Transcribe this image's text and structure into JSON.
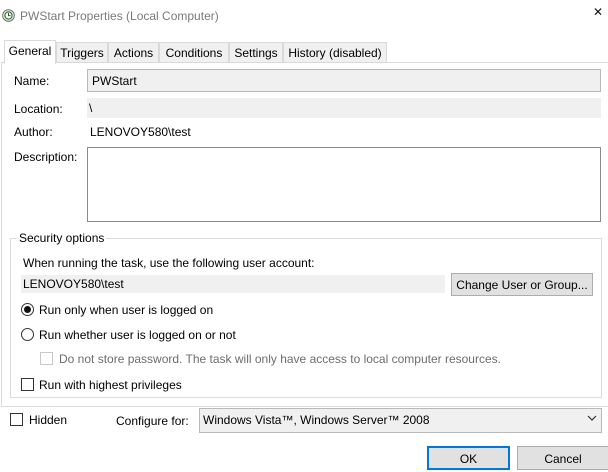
{
  "window": {
    "title": "PWStart Properties (Local Computer)",
    "close_glyph": "✕"
  },
  "tabs": [
    {
      "label": "General",
      "active": true
    },
    {
      "label": "Triggers"
    },
    {
      "label": "Actions"
    },
    {
      "label": "Conditions"
    },
    {
      "label": "Settings"
    },
    {
      "label": "History (disabled)"
    }
  ],
  "general": {
    "name_label": "Name:",
    "name_value": "PWStart",
    "location_label": "Location:",
    "location_value": "\\",
    "author_label": "Author:",
    "author_value": "LENOVOY580\\test",
    "description_label": "Description:",
    "description_value": ""
  },
  "security": {
    "legend": "Security options",
    "account_prompt": "When running the task, use the following user account:",
    "account_value": "LENOVOY580\\test",
    "change_button": "Change User or Group...",
    "radio_logged_on": "Run only when user is logged on",
    "radio_logged_on_checked": true,
    "radio_whether": "Run whether user is logged on or not",
    "no_store_password": "Do not store password.  The task will only have access to local computer resources.",
    "highest_privileges": "Run with highest privileges"
  },
  "footer": {
    "hidden_label": "Hidden",
    "configure_label": "Configure for:",
    "configure_value": "Windows Vista™, Windows Server™ 2008",
    "ok_button": "OK",
    "cancel_button": "Cancel"
  },
  "colors": {
    "accent": "#0078d7",
    "readonly_bg": "#f0f0f0",
    "button_bg": "#e1e1e1"
  },
  "icons": {
    "app": "task-scheduler-clock-icon",
    "close": "close-icon",
    "dropdown": "chevron-down-icon"
  }
}
